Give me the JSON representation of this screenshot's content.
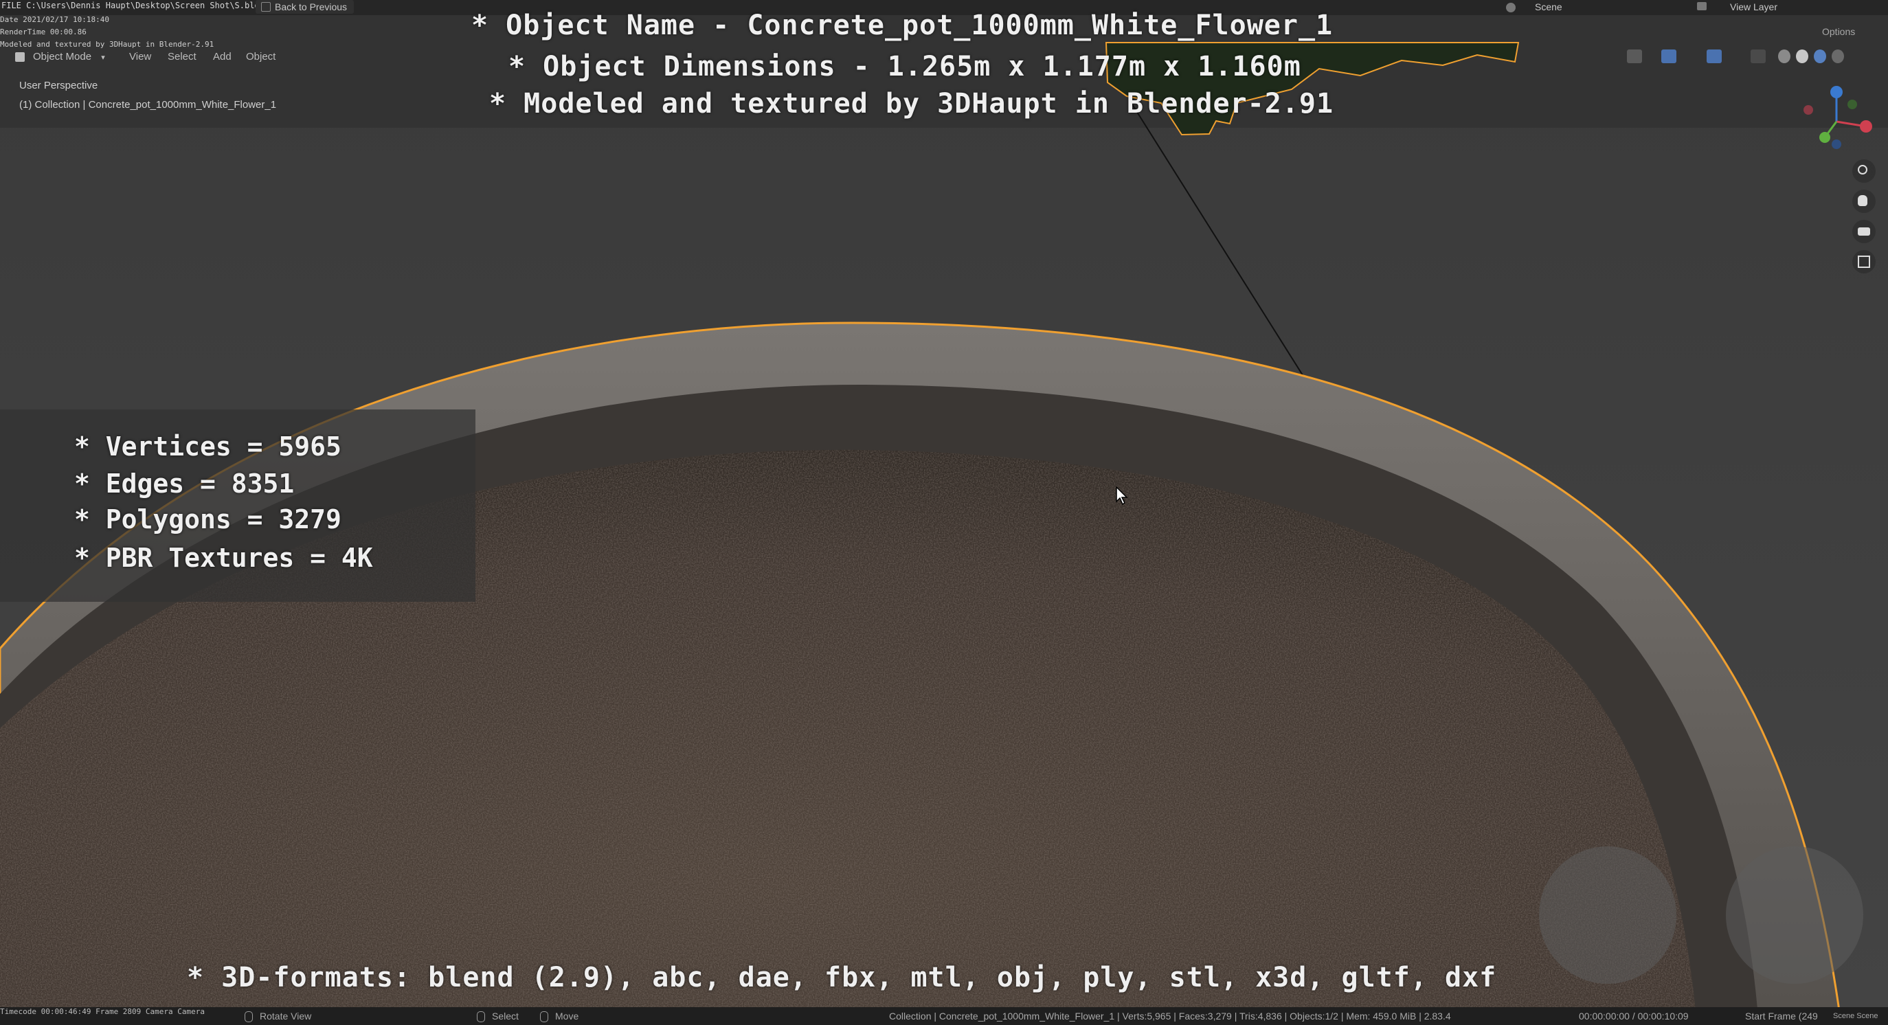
{
  "window": {
    "file_path": "FILE C:\\Users\\Dennis Haupt\\Desktop\\Screen Shot\\S.blend",
    "back_button": "Back to Previous",
    "scene_label": "Scene",
    "view_layer_label": "View Layer"
  },
  "render_info": {
    "date": "Date 2021/02/17 10:18:40",
    "render_time": "RenderTime 00:00.86",
    "note": "Modeled and textured by 3DHaupt in Blender-2.91"
  },
  "viewport_header": {
    "mode": "Object Mode",
    "menus": [
      "View",
      "Select",
      "Add",
      "Object"
    ],
    "options": "Options"
  },
  "viewport_info": {
    "perspective": "User Perspective",
    "collection": "(1) Collection | Concrete_pot_1000mm_White_Flower_1"
  },
  "overlay": {
    "title_line1": "* Object Name - Concrete_pot_1000mm_White_Flower_1",
    "title_line2": "* Object Dimensions -  1.265m x 1.177m x 1.160m",
    "title_line3": "* Modeled and textured by 3DHaupt in Blender-2.91",
    "stats": [
      "* Vertices = 5965",
      "* Edges = 8351",
      "* Polygons = 3279",
      "* PBR Textures = 4K"
    ],
    "formats": "* 3D-formats: blend (2.9), abc, dae, fbx, mtl, obj, ply, stl, x3d, gltf, dxf"
  },
  "statusbar": {
    "timecode": "Timecode 00:00:46:49  Frame 2809  Camera Camera",
    "rotate_view": "Rotate View",
    "select": "Select",
    "move": "Move",
    "scene_stats": "Collection | Concrete_pot_1000mm_White_Flower_1 | Verts:5,965 | Faces:3,279 | Tris:4,836 | Objects:1/2 | Mem: 459.0 MiB | 2.83.4",
    "time": "00:00:00:00 / 00:00:10:09",
    "start_frame": "Start Frame (249",
    "scene_right": "Scene  Scene"
  },
  "colors": {
    "selection_outline": "#f0a030",
    "soil": "#4a3f38",
    "rim": "#6e6a66",
    "viewport_bg": "#3d3d3d"
  }
}
